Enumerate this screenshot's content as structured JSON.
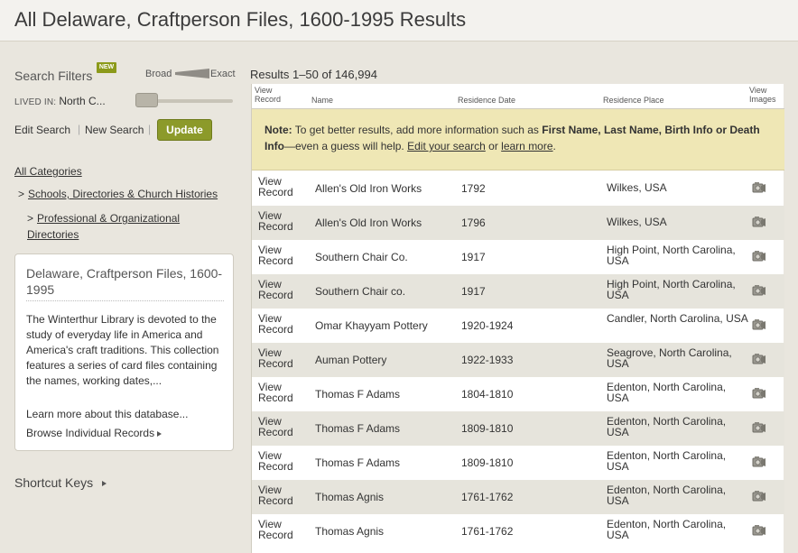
{
  "page": {
    "title": "All Delaware, Craftperson Files, 1600-1995 Results"
  },
  "filters": {
    "title": "Search Filters",
    "new_badge": "NEW",
    "broad_label": "Broad",
    "exact_label": "Exact",
    "lived_in_label": "LIVED IN:",
    "lived_in_value": "North C...",
    "edit_search": "Edit Search",
    "new_search": "New Search",
    "separator": "|",
    "update_button": "Update"
  },
  "categories": {
    "all": "All Categories",
    "arrow": ">",
    "level1": "Schools, Directories & Church Histories",
    "level2": "Professional & Organizational Directories"
  },
  "collection": {
    "title": "Delaware, Craftperson Files, 1600-1995",
    "description": "The Winterthur Library is devoted to the study of everyday life in America and America's craft traditions. This collection features a series of card files containing the names, working dates,...",
    "learn_more": "Learn more about this database...",
    "browse": "Browse Individual Records"
  },
  "shortcut_keys": "Shortcut Keys",
  "results": {
    "count_text": "Results 1–50 of 146,994",
    "headers": {
      "view_record_1": "View",
      "view_record_2": "Record",
      "name": "Name",
      "residence_date": "Residence Date",
      "residence_place": "Residence Place",
      "view_images_1": "View",
      "view_images_2": "Images"
    },
    "note": {
      "label": "Note:",
      "text_1": "To get better results, add more information such as",
      "bold_1": "First Name, Last Name, Birth Info or Death Info",
      "text_2": "—even a guess will help.",
      "link_1": "Edit your search",
      "text_3": "or",
      "link_2": "learn more",
      "text_4": "."
    },
    "view_line_1": "View",
    "view_line_2": "Record",
    "rows": [
      {
        "name": "Allen's Old Iron Works",
        "date": "1792",
        "place": "Wilkes, USA"
      },
      {
        "name": "Allen's Old Iron Works",
        "date": "1796",
        "place": "Wilkes, USA"
      },
      {
        "name": "Southern Chair Co.",
        "date": "1917",
        "place": "High Point, North Carolina, USA"
      },
      {
        "name": "Southern Chair co.",
        "date": "1917",
        "place": "High Point, North Carolina, USA"
      },
      {
        "name": "Omar Khayyam Pottery",
        "date": "1920-1924",
        "place": "Candler, North Carolina, USA"
      },
      {
        "name": "Auman Pottery",
        "date": "1922-1933",
        "place": "Seagrove, North Carolina, USA"
      },
      {
        "name": "Thomas F Adams",
        "date": "1804-1810",
        "place": "Edenton, North Carolina, USA"
      },
      {
        "name": "Thomas F Adams",
        "date": "1809-1810",
        "place": "Edenton, North Carolina, USA"
      },
      {
        "name": "Thomas F Adams",
        "date": "1809-1810",
        "place": "Edenton, North Carolina, USA"
      },
      {
        "name": "Thomas Agnis",
        "date": "1761-1762",
        "place": "Edenton, North Carolina, USA"
      },
      {
        "name": "Thomas Agnis",
        "date": "1761-1762",
        "place": "Edenton, North Carolina, USA"
      }
    ]
  },
  "colors": {
    "accent": "#8c9a2a",
    "note_bg": "#efe7b5",
    "row_alt": "#e6e4dc",
    "page_bg": "#e9e6de"
  },
  "icons": {
    "camera": "camera-icon",
    "wedge": "broad-exact-wedge-icon"
  }
}
